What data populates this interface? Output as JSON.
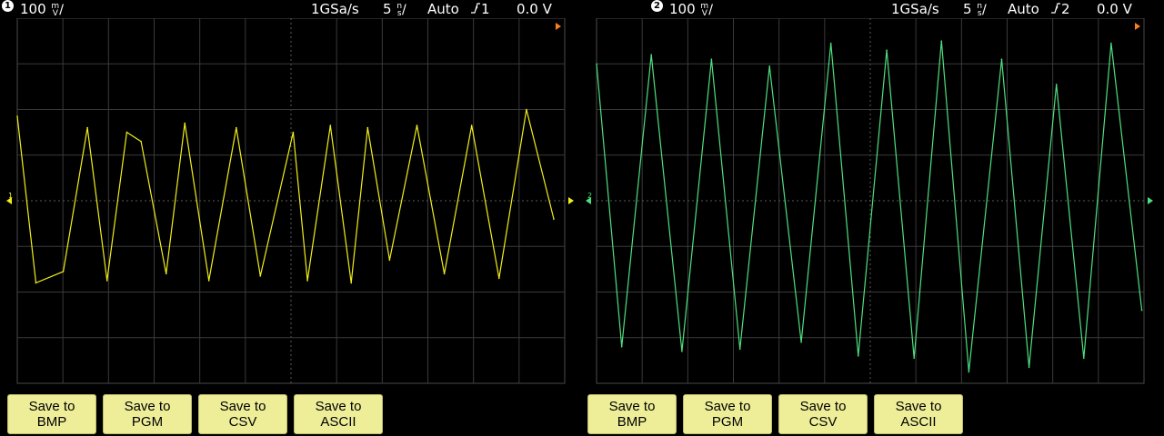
{
  "panels": [
    {
      "channel_number": "1",
      "channel_color": "#f2ef1a",
      "scale_value": "100",
      "scale_unit_top": "m",
      "scale_unit_bottom": "V",
      "sample_rate": "1GSa/s",
      "time_value": "5",
      "time_unit_top": "n",
      "time_unit_bottom": "s",
      "trigger_mode": "Auto",
      "trigger_icon": "rising-edge-icon",
      "trigger_source": "1",
      "trigger_level": "0.0 V",
      "ground_marker": "1",
      "buttons": [
        {
          "line1": "Save to",
          "line2": "BMP"
        },
        {
          "line1": "Save to",
          "line2": "PGM"
        },
        {
          "line1": "Save to",
          "line2": "CSV"
        },
        {
          "line1": "Save to",
          "line2": "ASCII"
        }
      ]
    },
    {
      "channel_number": "2",
      "channel_color": "#4ee07f",
      "scale_value": "100",
      "scale_unit_top": "m",
      "scale_unit_bottom": "V",
      "sample_rate": "1GSa/s",
      "time_value": "5",
      "time_unit_top": "n",
      "time_unit_bottom": "s",
      "trigger_mode": "Auto",
      "trigger_icon": "rising-edge-icon",
      "trigger_source": "2",
      "trigger_level": "0.0 V",
      "ground_marker": "2",
      "buttons": [
        {
          "line1": "Save to",
          "line2": "BMP"
        },
        {
          "line1": "Save to",
          "line2": "PGM"
        },
        {
          "line1": "Save to",
          "line2": "CSV"
        },
        {
          "line1": "Save to",
          "line2": "ASCII"
        }
      ]
    }
  ],
  "chart_data": [
    {
      "type": "line",
      "x_unit": "ns",
      "y_unit": "mV",
      "x": [
        0,
        1.7,
        4.2,
        6.4,
        8.2,
        10.0,
        11.3,
        13.6,
        15.3,
        17.5,
        20.0,
        22.2,
        25.2,
        26.5,
        28.6,
        30.5,
        32.0,
        34.0,
        36.5,
        39.0,
        41.5,
        44.0,
        46.5,
        49.0
      ],
      "y": [
        185,
        -180,
        -155,
        160,
        -175,
        150,
        130,
        -160,
        170,
        -175,
        160,
        -165,
        150,
        -175,
        165,
        -180,
        160,
        -130,
        165,
        -160,
        165,
        -170,
        200,
        -40
      ],
      "xlim": [
        0,
        50
      ],
      "ylim": [
        -400,
        400
      ]
    },
    {
      "type": "line",
      "x_unit": "ns",
      "y_unit": "mV",
      "x": [
        0,
        2.3,
        5.0,
        7.8,
        10.5,
        13.1,
        15.8,
        18.7,
        21.4,
        23.9,
        26.5,
        29.0,
        31.5,
        34.0,
        37.0,
        39.5,
        42.0,
        44.5,
        47.0,
        49.8
      ],
      "y": [
        300,
        -320,
        320,
        -330,
        310,
        -325,
        295,
        -310,
        345,
        -340,
        330,
        -345,
        350,
        -375,
        310,
        -365,
        255,
        -345,
        345,
        -240
      ],
      "xlim": [
        0,
        50
      ],
      "ylim": [
        -400,
        400
      ]
    }
  ]
}
